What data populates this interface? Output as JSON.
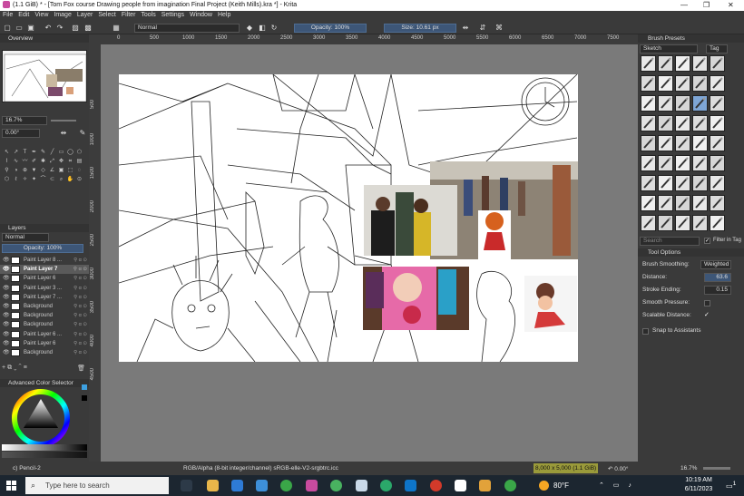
{
  "window": {
    "title": "(1.1 GiB)  * - [Tom Fox course Drawing people from imagination Final Project (Keith Mills).kra *] - Krita",
    "controls": [
      "—",
      "❐",
      "✕"
    ]
  },
  "menu": [
    "File",
    "Edit",
    "View",
    "Image",
    "Layer",
    "Select",
    "Filter",
    "Tools",
    "Settings",
    "Window",
    "Help"
  ],
  "toolbar": {
    "blend_mode": "Normal",
    "opacity": "Opacity: 100%",
    "size": "Size: 10.61 px"
  },
  "ruler_top": [
    "0",
    "500",
    "1000",
    "1500",
    "2000",
    "2500",
    "3000",
    "3500",
    "4000",
    "4500",
    "5000",
    "5500",
    "6000",
    "6500",
    "7000",
    "7500"
  ],
  "ruler_left": [
    "500",
    "1000",
    "1500",
    "2000",
    "2500",
    "3000",
    "3500",
    "4000",
    "4500"
  ],
  "overview": {
    "title": "Overview",
    "zoom": "16.7%",
    "rotation": "0.00°"
  },
  "layers": {
    "title": "Layers",
    "blend_mode": "Normal",
    "opacity": "Opacity: 100%",
    "items": [
      {
        "name": "Paint Layer 8 ...",
        "selected": false
      },
      {
        "name": "Paint Layer 7",
        "selected": true
      },
      {
        "name": "Paint Layer 6",
        "selected": false
      },
      {
        "name": "Paint Layer 3 ...",
        "selected": false
      },
      {
        "name": "Paint Layer 7 ...",
        "selected": false
      },
      {
        "name": "Background",
        "selected": false
      },
      {
        "name": "Background",
        "selected": false
      },
      {
        "name": "Background",
        "selected": false
      },
      {
        "name": "Paint Layer 6 ...",
        "selected": false
      },
      {
        "name": "Paint Layer 6",
        "selected": false
      },
      {
        "name": "Background",
        "selected": false
      }
    ]
  },
  "color_selector": {
    "title": "Advanced Color Selector"
  },
  "brush_presets": {
    "title": "Brush Presets",
    "tag": "Sketch",
    "tag_button": "Tag",
    "search_placeholder": "Search",
    "filter_label": "Filter in Tag"
  },
  "tool_options": {
    "title": "Tool Options",
    "brush_smoothing_label": "Brush Smoothing:",
    "brush_smoothing_value": "Weighted",
    "distance_label": "Distance:",
    "distance_value": "63.6",
    "stroke_ending_label": "Stroke Ending:",
    "stroke_ending_value": "0.15",
    "smooth_pressure_label": "Smooth Pressure:",
    "scalable_distance_label": "Scalable Distance:",
    "snap_label": "Snap to Assistants"
  },
  "status": {
    "brush": "c) Pencil-2",
    "color_model": "RGB/Alpha (8-bit integer/channel)  sRGB-elle-V2-srgbtrc.icc",
    "dimensions": "8,000 x 5,000 (1.1 GiB)",
    "rotation": "0.00°",
    "zoom": "16.7%"
  },
  "taskbar": {
    "search_placeholder": "Type here to search",
    "weather": "80°F",
    "time": "10:19 AM",
    "date": "6/11/2023",
    "notifications": "1"
  },
  "colors": {
    "accent": "#3d5677",
    "panel": "#3a3a3a",
    "canvas_bg": "#7a7a7a",
    "taskbar": "#1c2630",
    "status_highlight": "#9a9a3a"
  }
}
